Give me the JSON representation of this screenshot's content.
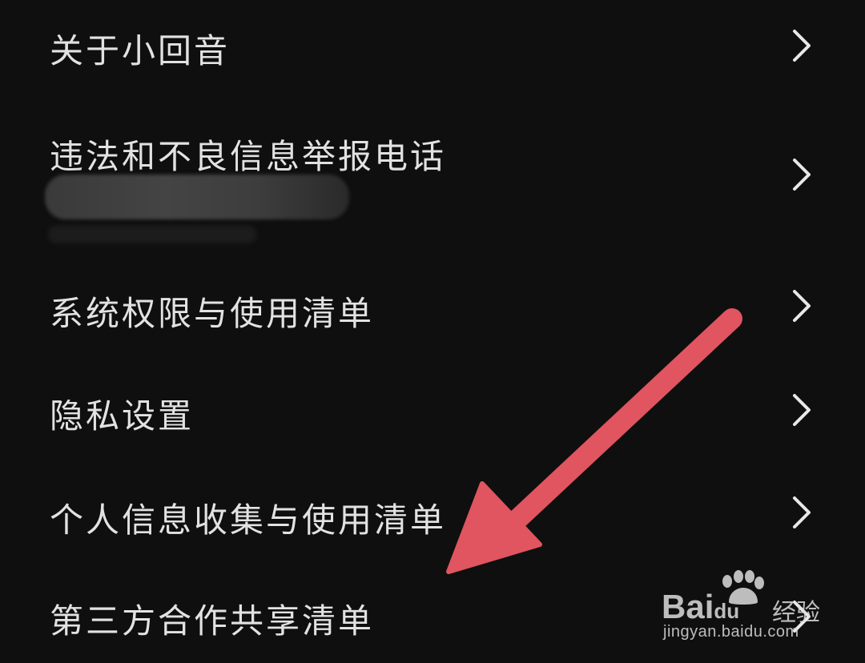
{
  "settings_list": {
    "items": [
      {
        "label": "关于小回音"
      },
      {
        "label": "违法和不良信息举报电话"
      },
      {
        "label": "系统权限与使用清单"
      },
      {
        "label": "隐私设置"
      },
      {
        "label": "个人信息收集与使用清单"
      },
      {
        "label": "第三方合作共享清单"
      }
    ],
    "chevron_icon": "chevron-right-icon"
  },
  "annotation": {
    "arrow_color": "#e05560"
  },
  "watermark": {
    "brand": "Bai",
    "brand_du": "du",
    "suffix": "经验",
    "url": "jingyan.baidu.com"
  },
  "colors": {
    "background": "#0f0f0f",
    "text": "#e2e2e2",
    "chevron": "#e8e8e8"
  }
}
